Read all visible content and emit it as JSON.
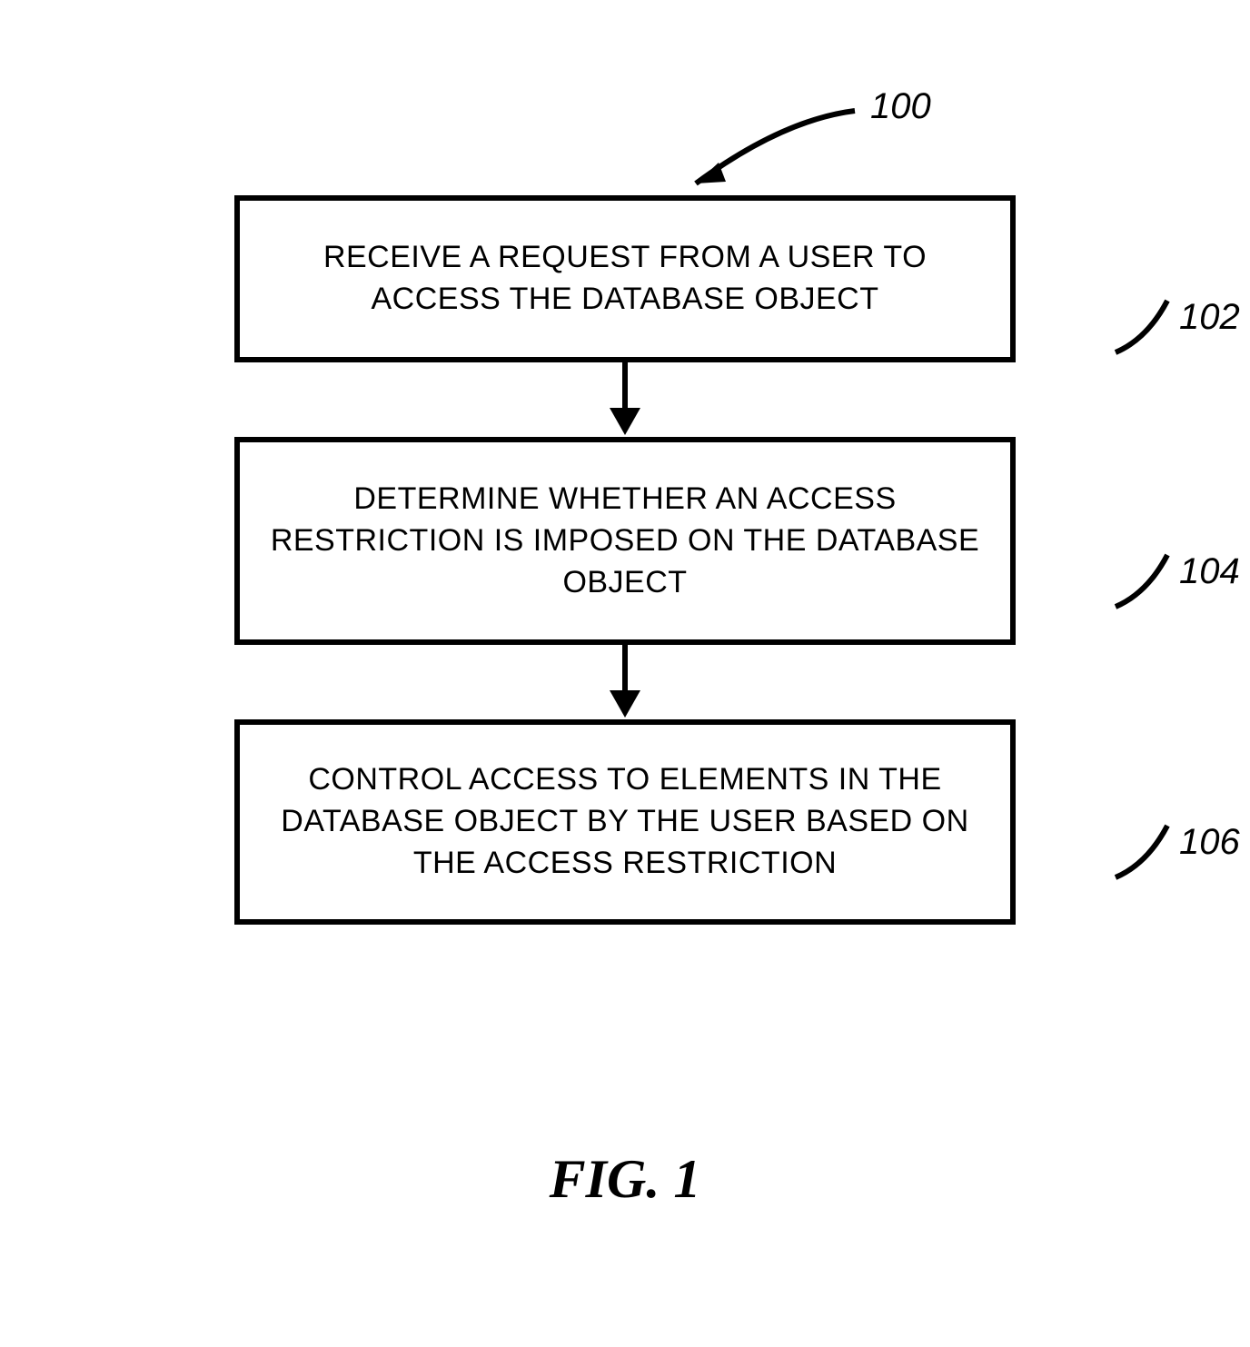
{
  "diagram": {
    "title_ref": "100",
    "caption": "FIG. 1",
    "boxes": [
      {
        "ref": "102",
        "text": "RECEIVE A REQUEST FROM A USER TO ACCESS THE DATABASE OBJECT"
      },
      {
        "ref": "104",
        "text": "DETERMINE WHETHER AN ACCESS RESTRICTION IS IMPOSED ON THE DATABASE OBJECT"
      },
      {
        "ref": "106",
        "text": "CONTROL ACCESS TO ELEMENTS IN THE DATABASE OBJECT BY THE USER BASED ON THE ACCESS RESTRICTION"
      }
    ]
  }
}
